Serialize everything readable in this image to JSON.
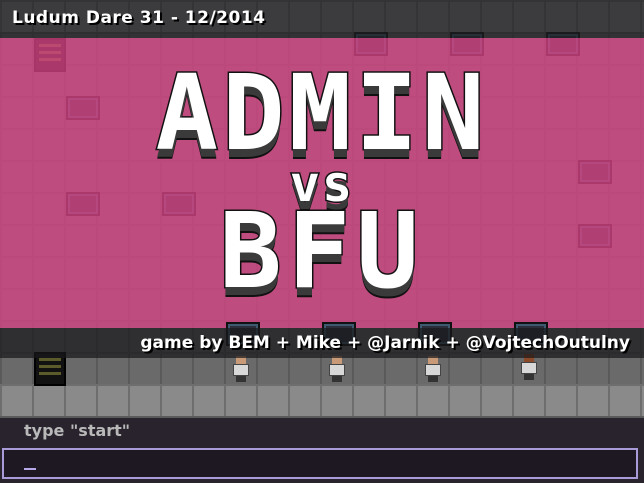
{
  "header": {
    "subtitle": "Ludum Dare 31 - 12/2014"
  },
  "logo": {
    "line1": "ADMIN",
    "line2": "vs",
    "line3": "BFU"
  },
  "credits": "game by BEM + Mike + @Jarnik + @VojtechOutulny",
  "console": {
    "prompt": "type \"start\"",
    "input_value": ""
  },
  "colors": {
    "overlay_pink": "#d64484",
    "input_border": "#a99ad8",
    "console_bg": "#28232c"
  }
}
